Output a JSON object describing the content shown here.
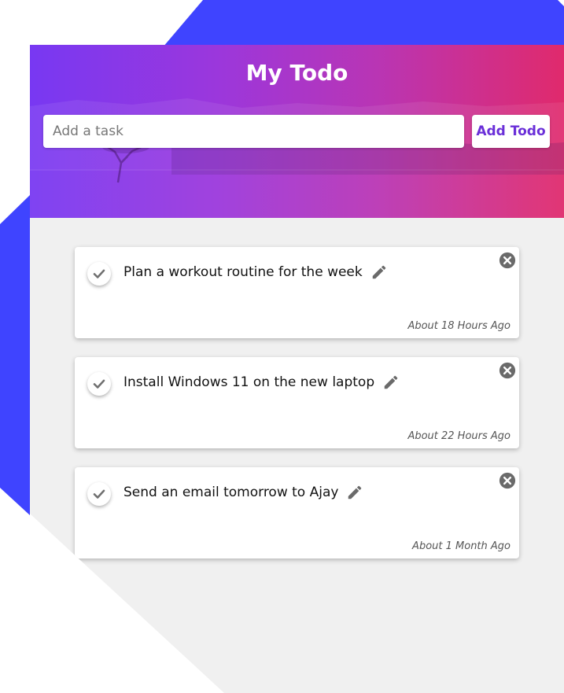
{
  "app": {
    "title": "My Todo"
  },
  "add_form": {
    "placeholder": "Add a task",
    "value": "",
    "button_label": "Add Todo"
  },
  "todos": [
    {
      "text": "Plan a workout routine for the week",
      "time": "About 18 Hours Ago"
    },
    {
      "text": "Install Windows 11 on the new laptop",
      "time": "About 22 Hours Ago"
    },
    {
      "text": "Send an email tomorrow to Ajay",
      "time": "About 1 Month Ago"
    }
  ],
  "icons": {
    "complete": "check-icon",
    "edit": "pencil-icon",
    "delete": "close-circle-icon"
  },
  "colors": {
    "accent_blue": "#3f44ff",
    "gradient_start": "#7838f2",
    "gradient_end": "#e02a6c",
    "button_text": "#6a2fd8",
    "panel_bg": "#f0f0f0"
  }
}
